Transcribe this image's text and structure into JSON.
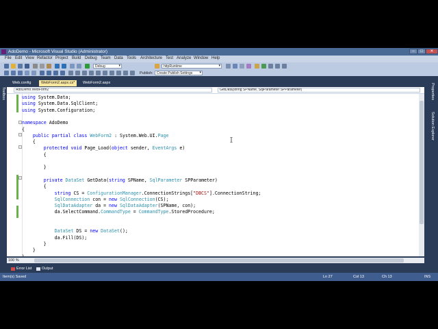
{
  "window": {
    "title": "AdoDemo - Microsoft Visual Studio (Administrator)",
    "min_glyph": "–",
    "max_glyph": "□",
    "close_glyph": "✕"
  },
  "menu": [
    "File",
    "Edit",
    "View",
    "Refactor",
    "Project",
    "Build",
    "Debug",
    "Team",
    "Data",
    "Tools",
    "Architecture",
    "Test",
    "Analyze",
    "Window",
    "Help"
  ],
  "toolbar": {
    "config": "Debug",
    "target": "httpRuntime",
    "publish_label": "Publish:",
    "publish_value": "Create Publish Settings"
  },
  "doc_tabs": [
    {
      "label": "Web.config",
      "active": false
    },
    {
      "label": "WebForm2.aspx.cs*",
      "active": true
    },
    {
      "label": "WebForm2.aspx",
      "active": false
    }
  ],
  "navbar": {
    "class_combo": "AdoDemo.WebForm2",
    "member_combo": "GetData(string SPName, SqlParameter SPParameter)"
  },
  "side_panels": {
    "left": "Toolbox",
    "right": [
      "Properties",
      "Solution Explorer"
    ]
  },
  "code_lines": [
    {
      "t": "using System.Data;",
      "c": "kw-using"
    },
    {
      "t": "using System.Data.SqlClient;",
      "c": "kw-using"
    },
    {
      "t": "using System.Configuration;",
      "c": "kw-using"
    },
    {
      "t": "",
      "c": ""
    },
    {
      "t": "namespace AdoDemo",
      "c": "kw-ns"
    },
    {
      "t": "{",
      "c": ""
    },
    {
      "t": "    public partial class WebForm2 : System.Web.UI.Page",
      "c": "class"
    },
    {
      "t": "    {",
      "c": ""
    },
    {
      "t": "        protected void Page_Load(object sender, EventArgs e)",
      "c": "method1"
    },
    {
      "t": "        {",
      "c": ""
    },
    {
      "t": "",
      "c": ""
    },
    {
      "t": "        }",
      "c": ""
    },
    {
      "t": "",
      "c": ""
    },
    {
      "t": "        private DataSet GetData(string SPName, SqlParameter SPParameter)",
      "c": "method2"
    },
    {
      "t": "        {",
      "c": ""
    },
    {
      "t": "            string CS = ConfigurationManager.ConnectionStrings[\"DBCS\"].ConnectionString;",
      "c": "cs"
    },
    {
      "t": "            SqlConnection con = new SqlConnection(CS);",
      "c": "con"
    },
    {
      "t": "            SqlDataAdapter da = new SqlDataAdapter(SPName, con);",
      "c": "da"
    },
    {
      "t": "            da.SelectCommand.CommandType = CommandType.StoredProcedure;",
      "c": "cmd"
    },
    {
      "t": "",
      "c": ""
    },
    {
      "t": "",
      "c": ""
    },
    {
      "t": "            DataSet DS = new DataSet();",
      "c": "ds"
    },
    {
      "t": "            da.Fill(DS);",
      "c": ""
    },
    {
      "t": "        }",
      "c": ""
    },
    {
      "t": "    }",
      "c": ""
    },
    {
      "t": "}",
      "c": ""
    }
  ],
  "editor": {
    "zoom": "100 %"
  },
  "bottom_tabs": [
    "Error List",
    "Output"
  ],
  "status": {
    "message": "Item(s) Saved",
    "ln": "Ln 27",
    "col": "Col 13",
    "ch": "Ch 13",
    "mode": "INS"
  },
  "colors": {
    "keyword": "#0000ff",
    "type": "#2b91af",
    "string": "#a31515",
    "chrome": "#2b3c59",
    "active_tab": "#fbe8a1"
  }
}
